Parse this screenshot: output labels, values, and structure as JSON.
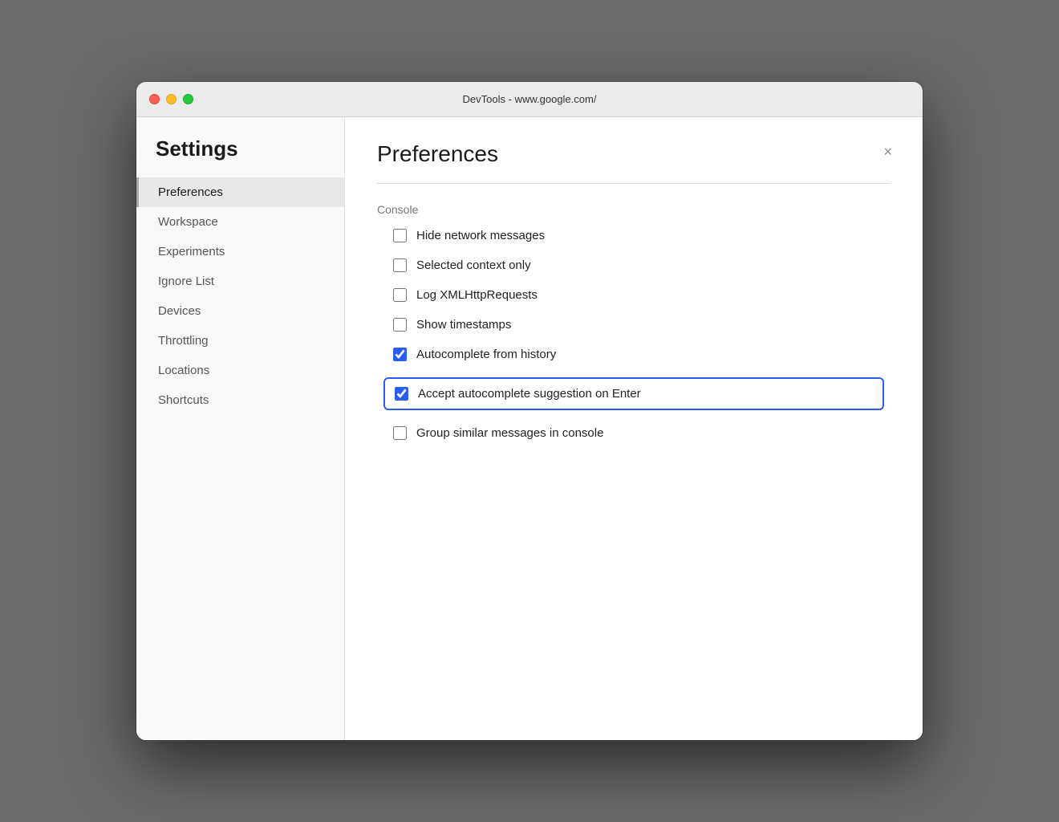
{
  "titlebar": {
    "title": "DevTools - www.google.com/"
  },
  "sidebar": {
    "heading": "Settings",
    "items": [
      {
        "id": "preferences",
        "label": "Preferences",
        "active": true
      },
      {
        "id": "workspace",
        "label": "Workspace",
        "active": false
      },
      {
        "id": "experiments",
        "label": "Experiments",
        "active": false
      },
      {
        "id": "ignore-list",
        "label": "Ignore List",
        "active": false
      },
      {
        "id": "devices",
        "label": "Devices",
        "active": false
      },
      {
        "id": "throttling",
        "label": "Throttling",
        "active": false
      },
      {
        "id": "locations",
        "label": "Locations",
        "active": false
      },
      {
        "id": "shortcuts",
        "label": "Shortcuts",
        "active": false
      }
    ]
  },
  "main": {
    "title": "Preferences",
    "close_label": "×",
    "subsection": "Console",
    "checkboxes": [
      {
        "id": "hide-network",
        "label": "Hide network messages",
        "checked": false,
        "highlighted": false
      },
      {
        "id": "selected-context",
        "label": "Selected context only",
        "checked": false,
        "highlighted": false
      },
      {
        "id": "log-xmlhttp",
        "label": "Log XMLHttpRequests",
        "checked": false,
        "highlighted": false
      },
      {
        "id": "show-timestamps",
        "label": "Show timestamps",
        "checked": false,
        "highlighted": false
      },
      {
        "id": "autocomplete-history",
        "label": "Autocomplete from history",
        "checked": true,
        "highlighted": false
      },
      {
        "id": "accept-autocomplete",
        "label": "Accept autocomplete suggestion on Enter",
        "checked": true,
        "highlighted": true
      },
      {
        "id": "group-similar",
        "label": "Group similar messages in console",
        "checked": false,
        "highlighted": false
      }
    ]
  }
}
